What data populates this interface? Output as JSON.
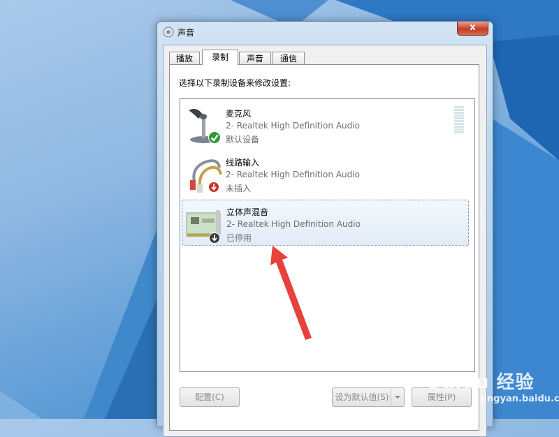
{
  "window": {
    "title": "声音",
    "close_glyph": "x"
  },
  "tabs": [
    {
      "label": "播放",
      "active": false
    },
    {
      "label": "录制",
      "active": true
    },
    {
      "label": "声音",
      "active": false
    },
    {
      "label": "通信",
      "active": false
    }
  ],
  "instruction": "选择以下录制设备来修改设置:",
  "devices": [
    {
      "name": "麦克风",
      "driver": "2- Realtek High Definition Audio",
      "status": "默认设备",
      "icon": "microphone-icon",
      "badge": "default-check-icon"
    },
    {
      "name": "线路输入",
      "driver": "2- Realtek High Definition Audio",
      "status": "未插入",
      "icon": "rca-cable-icon",
      "badge": "unplugged-icon"
    },
    {
      "name": "立体声混音",
      "driver": "2- Realtek High Definition Audio",
      "status": "已停用",
      "icon": "sound-card-icon",
      "badge": "disabled-icon",
      "selected": true
    }
  ],
  "buttons": {
    "configure": "配置(C)",
    "set_default": "设为默认值(S)",
    "properties": "属性(P)"
  },
  "watermark": {
    "main": "Baidu 经验",
    "sub": "jingyan.baidu.com"
  },
  "colors": {
    "accent_arrow": "#e8403a",
    "selection": "#e1ecf8",
    "check_green": "#2e9b33",
    "status_gray": "#6d6d6d"
  }
}
